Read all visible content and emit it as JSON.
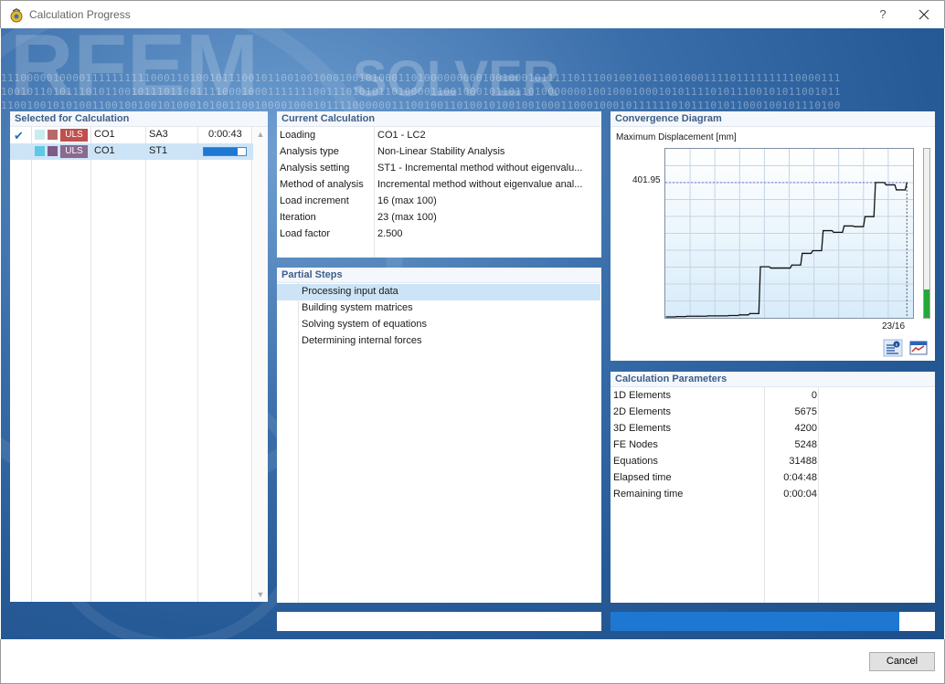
{
  "window": {
    "title": "Calculation Progress",
    "help": "?",
    "close": "✕"
  },
  "banner": {
    "logo": "RFEM",
    "subtitle": "SOLVER",
    "binary_lines": [
      "111000001000011111111110001101001011100101100100100010010100011010000000001001000101111101110010010011001000111101111111110000111",
      "100101101011101011001011101100111100010001111111001110101011010000110010001011011010000000100100010001010111101011100101011001011",
      "110010010101001100100100101000101001100100001000101111000000111001001101001010010010001100010001011111101011101011000100101110100"
    ]
  },
  "selected": {
    "title": "Selected for Calculation",
    "rows": [
      {
        "check": "✔",
        "type": "ULS",
        "co": "CO1",
        "case": "SA3",
        "time": "0:00:43",
        "swatch1": "#c8ecf0",
        "swatch2": "#b86a6a",
        "badge_color": "#c0504d",
        "active": false
      },
      {
        "check": "",
        "type": "ULS",
        "co": "CO1",
        "case": "ST1",
        "time": "",
        "progress": 0.8,
        "swatch1": "#5fc8e6",
        "swatch2": "#7e5a86",
        "badge_color": "#8a6a8e",
        "active": true
      }
    ]
  },
  "current": {
    "title": "Current Calculation",
    "rows": [
      {
        "k": "Loading",
        "v": "CO1 - LC2"
      },
      {
        "k": "Analysis type",
        "v": "Non-Linear Stability Analysis"
      },
      {
        "k": "Analysis setting",
        "v": "ST1 - Incremental method without eigenvalu..."
      },
      {
        "k": "Method of analysis",
        "v": "Incremental method without eigenvalue anal..."
      },
      {
        "k": "Load increment",
        "v": "16 (max 100)"
      },
      {
        "k": "Iteration",
        "v": "23 (max 100)"
      },
      {
        "k": "Load factor",
        "v": "2.500"
      }
    ]
  },
  "partial": {
    "title": "Partial Steps",
    "steps": [
      "Processing input data",
      "Building system matrices",
      "Solving system of equations",
      "Determining internal forces"
    ],
    "active_index": 0
  },
  "convergence": {
    "title": "Convergence Diagram",
    "subtitle": "Maximum Displacement [mm]",
    "ymax_label": "401.95",
    "x_label": "23/16",
    "level": 0.17,
    "info_icon": "info-list-icon",
    "export_icon": "export-chart-icon"
  },
  "chart_data": {
    "type": "line",
    "title": "Maximum Displacement [mm]",
    "x": [
      0,
      1,
      2,
      3,
      4,
      5,
      6,
      7,
      8,
      9,
      10,
      11,
      12,
      13,
      14,
      15,
      16,
      17,
      18,
      19,
      20,
      21,
      22,
      23
    ],
    "series": [
      {
        "name": "Maximum Displacement [mm]",
        "values": [
          0,
          1,
          2,
          2,
          3,
          3,
          4,
          6,
          10,
          150,
          146,
          146,
          155,
          190,
          198,
          258,
          253,
          272,
          270,
          300,
          402,
          395,
          380,
          401.95
        ]
      }
    ],
    "xlabel": "",
    "ylabel": "Maximum Displacement [mm]",
    "ylim": [
      0,
      500
    ],
    "current_point_label": "23/16",
    "grid": true
  },
  "params": {
    "title": "Calculation Parameters",
    "rows": [
      {
        "k": "1D Elements",
        "v": "0"
      },
      {
        "k": "2D Elements",
        "v": "5675"
      },
      {
        "k": "3D Elements",
        "v": "4200"
      },
      {
        "k": "FE Nodes",
        "v": "5248"
      },
      {
        "k": "Equations",
        "v": "31488"
      },
      {
        "k": "Elapsed time",
        "v": "0:04:48"
      },
      {
        "k": "Remaining time",
        "v": "0:00:04"
      }
    ]
  },
  "progress": {
    "steps": 0.0,
    "overall": 0.89
  },
  "footer": {
    "cancel": "Cancel"
  }
}
